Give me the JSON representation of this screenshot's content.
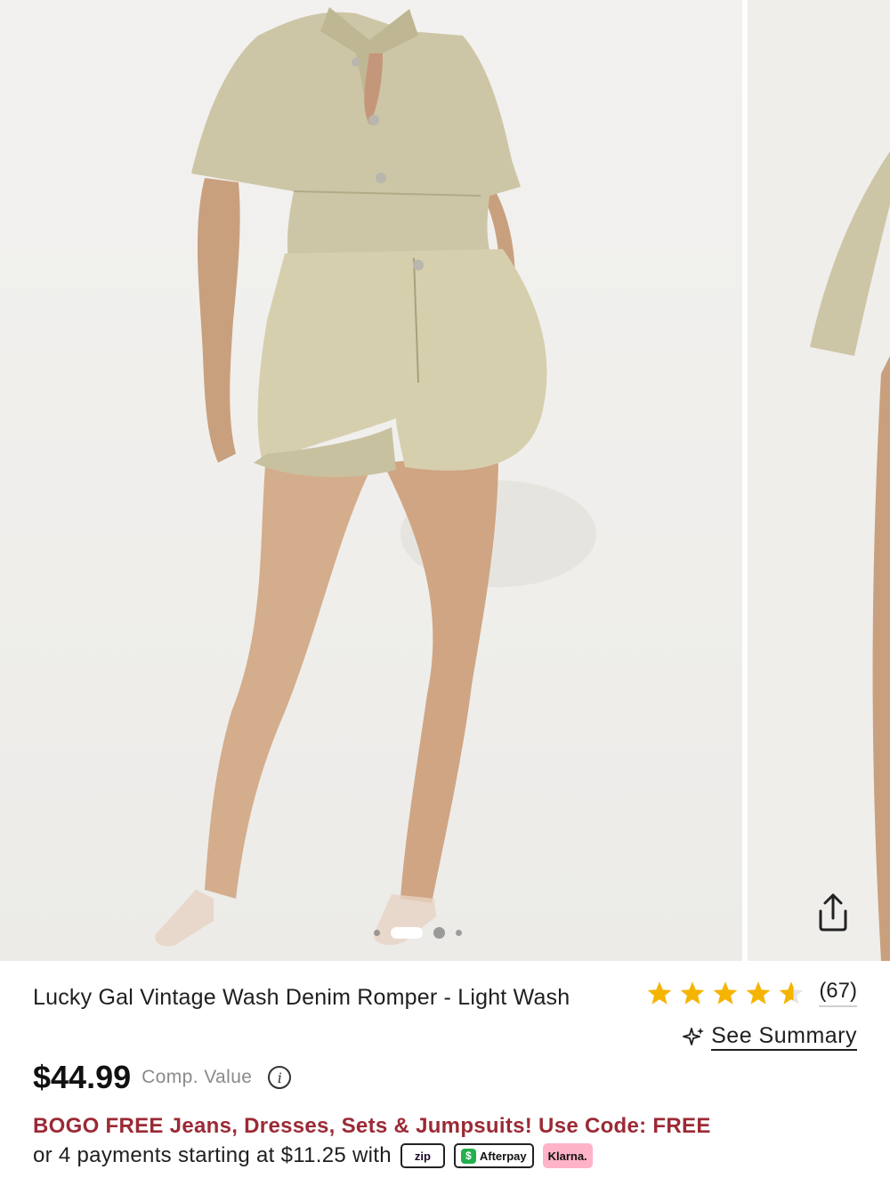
{
  "gallery": {
    "main_image_alt": "Model wearing vintage wash denim romper",
    "next_image_alt": "Alternate view of denim romper",
    "dots_count": 4,
    "active_dot_index": 1
  },
  "product": {
    "title": "Lucky Gal Vintage Wash Denim Romper - Light Wash",
    "rating": 4.5,
    "review_count": "(67)",
    "see_summary": "See Summary",
    "price": "$44.99",
    "comp_value_label": "Comp. Value",
    "info_glyph": "i",
    "promo": "BOGO FREE Jeans, Dresses, Sets & Jumpsuits! Use Code: FREE",
    "payments_text": "or 4 payments starting at $11.25 with",
    "payment_badges": {
      "zip": "zip",
      "afterpay": "Afterpay",
      "afterpay_glyph": "$",
      "klarna": "Klarna."
    }
  },
  "colors": {
    "star": "#f5b400",
    "promo": "#9b2a35",
    "klarna": "#ffb3c7",
    "afterpay": "#22b14c"
  },
  "icons": {
    "share": "share-icon",
    "sparkle": "sparkle-icon",
    "info": "info-icon",
    "star": "star-icon"
  }
}
